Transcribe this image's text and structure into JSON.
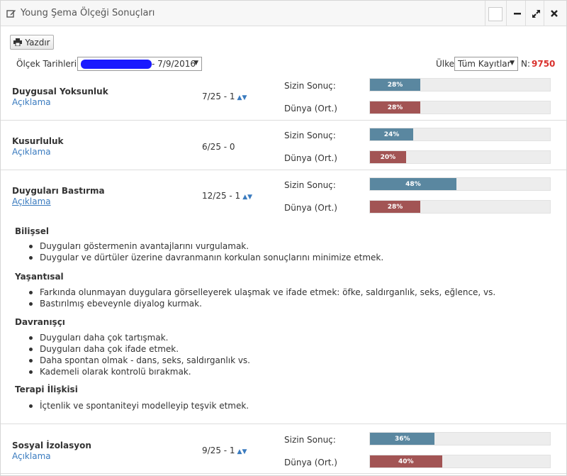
{
  "window": {
    "title": "Young Şema Ölçeği Sonuçları",
    "icons": {
      "title": "edit-icon",
      "minimize": "minimize-icon",
      "expand": "expand-icon",
      "close": "close-icon"
    }
  },
  "toolbar": {
    "print_label": "Yazdır",
    "print_icon": "printer-icon"
  },
  "filters": {
    "date_label": "Ölçek Tarihleri :",
    "date_value": "- 7/9/2016",
    "country_label": "Ülke",
    "country_value": "Tüm Kayıtlar",
    "n_label": "N:",
    "n_value": "9750"
  },
  "labels": {
    "your_result": "Sizin Sonuç:",
    "world_avg": "Dünya (Ort.)",
    "description": "Açıklama"
  },
  "colors": {
    "your_bar": "#5a87a0",
    "world_bar": "#a25454",
    "link": "#3a7bbf",
    "n_value": "#d9302c"
  },
  "schemas": [
    {
      "name": "Duygusal Yoksunluk",
      "score": "7/25 - 1",
      "sortable": true,
      "your_pct": 28,
      "your_text": "28%",
      "world_pct": 28,
      "world_text": "28%"
    },
    {
      "name": "Kusurluluk",
      "score": "6/25 - 0",
      "sortable": false,
      "your_pct": 24,
      "your_text": "24%",
      "world_pct": 20,
      "world_text": "20%"
    },
    {
      "name": "Duyguları Bastırma",
      "score": "12/25 - 1",
      "sortable": true,
      "your_pct": 48,
      "your_text": "48%",
      "world_pct": 28,
      "world_text": "28%"
    },
    {
      "name": "Sosyal İzolasyon",
      "score": "9/25 - 1",
      "sortable": true,
      "your_pct": 36,
      "your_text": "36%",
      "world_pct": 40,
      "world_text": "40%"
    }
  ],
  "details": [
    {
      "heading": "Bilişsel",
      "items": [
        "Duyguları göstermenin avantajlarını vurgulamak.",
        "Duygular ve dürtüler üzerine davranmanın korkulan sonuçlarını minimize etmek."
      ]
    },
    {
      "heading": "Yaşantısal",
      "items": [
        "Farkında olunmayan duygulara görselleyerek ulaşmak ve ifade etmek: öfke, saldırganlık, seks, eğlence, vs.",
        "Bastırılmış ebeveynle diyalog kurmak."
      ]
    },
    {
      "heading": "Davranışçı",
      "items": [
        "Duyguları daha çok tartışmak.",
        "Duyguları daha çok ifade etmek.",
        "Daha spontan olmak - dans, seks, saldırganlık vs.",
        "Kademeli olarak kontrolü bırakmak."
      ]
    },
    {
      "heading": "Terapi İlişkisi",
      "items": [
        "İçtenlik ve spontaniteyi modelleyip teşvik etmek."
      ]
    }
  ]
}
